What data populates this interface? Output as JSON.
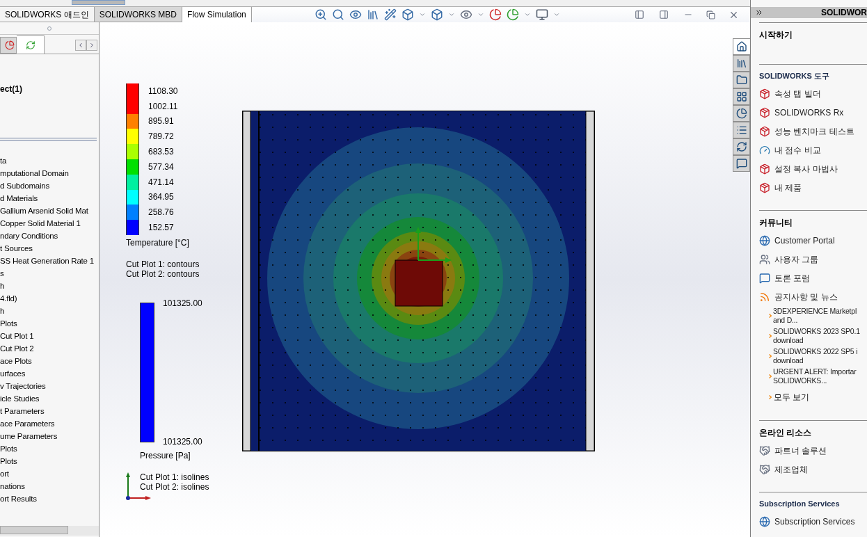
{
  "tabs": [
    {
      "label": "SOLIDWORKS 애드인",
      "selected": false
    },
    {
      "label": "SOLIDWORKS MBD",
      "selected": false
    },
    {
      "label": "Flow Simulation",
      "selected": true
    }
  ],
  "left_panel": {
    "title": "ect(1)",
    "tree": [
      "ta",
      "mputational Domain",
      "d Subdomains",
      "d Materials",
      "Gallium Arsenid Solid Mat",
      "Copper Solid Material 1",
      "ndary Conditions",
      "t Sources",
      "SS Heat Generation Rate 1",
      "s",
      "h",
      "4.fld)",
      "h",
      "Plots",
      "Cut Plot 1",
      "Cut Plot 2",
      "ace Plots",
      "urfaces",
      "v Trajectories",
      "icle Studies",
      "t Parameters",
      "ace Parameters",
      "ume Parameters",
      "Plots",
      "Plots",
      "ort",
      "nations",
      "ort Results"
    ]
  },
  "temperature_legend": {
    "title": "Temperature [°C]",
    "ticks": [
      {
        "label": "1108.30",
        "color": "#ff0000"
      },
      {
        "label": "1002.11",
        "color": "#ff0000"
      },
      {
        "label": "895.91",
        "color": "#ff8000"
      },
      {
        "label": "789.72",
        "color": "#ffff00"
      },
      {
        "label": "683.53",
        "color": "#aaff00"
      },
      {
        "label": "577.34",
        "color": "#00e000"
      },
      {
        "label": "471.14",
        "color": "#00f0a0"
      },
      {
        "label": "364.95",
        "color": "#00ffff"
      },
      {
        "label": "258.76",
        "color": "#0080ff"
      },
      {
        "label": "152.57",
        "color": "#0000ff"
      }
    ]
  },
  "contour_notes": [
    "Cut Plot 1: contours",
    "Cut Plot 2: contours"
  ],
  "pressure_legend": {
    "title": "Pressure [Pa]",
    "max": "101325.00",
    "min": "101325.00"
  },
  "isoline_notes": [
    "Cut Plot 1: isolines",
    "Cut Plot 2: isolines"
  ],
  "side_tabs": [
    {
      "selected": true
    },
    {
      "selected": false
    },
    {
      "selected": false
    },
    {
      "selected": false
    },
    {
      "selected": false
    },
    {
      "selected": false
    },
    {
      "selected": false
    },
    {
      "selected": false
    }
  ],
  "right_panel": {
    "header": "SOLIDWOR",
    "sections": [
      {
        "title": "시작하기"
      },
      {
        "title": "SOLIDWORKS 도구",
        "items": [
          {
            "kind": "tool",
            "label": "속성 탭 빌더"
          },
          {
            "kind": "tool",
            "label": "SOLIDWORKS Rx"
          },
          {
            "kind": "tool",
            "label": "성능 벤치마크 테스트"
          },
          {
            "kind": "compare",
            "label": "내 점수 비교"
          },
          {
            "kind": "tool",
            "label": "설정 복사 마법사"
          },
          {
            "kind": "tool",
            "label": "내 제품"
          }
        ]
      },
      {
        "title": "커뮤니티",
        "items": [
          {
            "kind": "globe",
            "label": "Customer Portal"
          },
          {
            "kind": "group",
            "label": "사용자 그룹"
          },
          {
            "kind": "forum",
            "label": "토론 포럼"
          },
          {
            "kind": "rss",
            "label": "공지사항 및 뉴스"
          },
          {
            "kind": "news",
            "lines": [
              "3DEXPERIENCE Marketpl",
              "and D..."
            ]
          },
          {
            "kind": "news",
            "lines": [
              "SOLIDWORKS 2023 SP0.1",
              "download"
            ]
          },
          {
            "kind": "news",
            "lines": [
              "SOLIDWORKS 2022 SP5 i",
              "download"
            ]
          },
          {
            "kind": "news",
            "lines": [
              "URGENT ALERT: Importar",
              "SOLIDWORKS..."
            ]
          },
          {
            "kind": "more",
            "label": "모두 보기"
          }
        ]
      },
      {
        "title": "온라인 리소스",
        "items": [
          {
            "kind": "handshake",
            "label": "파트너 솔루션"
          },
          {
            "kind": "handshake",
            "label": "제조업체"
          }
        ]
      },
      {
        "title": "Subscription Services",
        "items": [
          {
            "kind": "globe",
            "label": "Subscription Services"
          }
        ]
      }
    ]
  }
}
